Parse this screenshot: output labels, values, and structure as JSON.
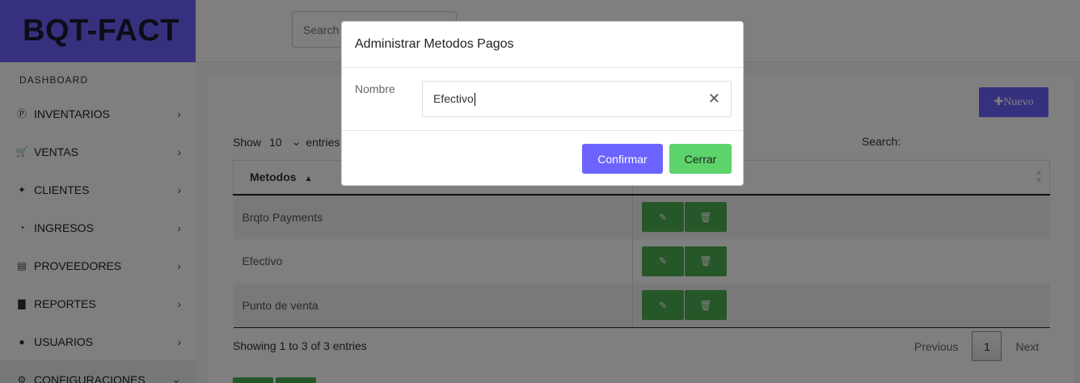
{
  "app": {
    "brand": "BQT-FACT"
  },
  "topbar": {
    "search_placeholder": "Search"
  },
  "sidebar": {
    "dashboard_label": "DASHBOARD",
    "items": [
      {
        "label": "INVENTARIOS",
        "icon": "Ⓟ"
      },
      {
        "label": "VENTAS",
        "icon": "🛒"
      },
      {
        "label": "CLIENTES",
        "icon": "✦"
      },
      {
        "label": "INGRESOS",
        "icon": "◔"
      },
      {
        "label": "PROVEEDORES",
        "icon": "▤"
      },
      {
        "label": "REPORTES",
        "icon": "▇"
      },
      {
        "label": "USUARIOS",
        "icon": "●"
      },
      {
        "label": "CONFIGURACIONES",
        "icon": "⚙"
      }
    ]
  },
  "main": {
    "new_button": "✚Nuevo",
    "show_label": "Show",
    "page_length": "10",
    "entries_label": "entries",
    "search_label": "Search:",
    "table": {
      "headers": [
        "Metodos",
        ""
      ],
      "rows": [
        {
          "metodo": "Brqto Payments"
        },
        {
          "metodo": "Efectivo"
        },
        {
          "metodo": "Punto de venta"
        }
      ]
    },
    "info": "Showing 1 to 3 of 3 entries",
    "pagination": {
      "previous": "Previous",
      "current": "1",
      "next": "Next"
    }
  },
  "modal": {
    "title": "Administrar Metodos Pagos",
    "field_label": "Nombre",
    "field_value": "Efectivo",
    "confirm_label": "Confirmar",
    "close_label": "Cerrar"
  },
  "colors": {
    "accent": "#6c63ff",
    "success": "#4caf50",
    "close_btn": "#5dd36b"
  }
}
